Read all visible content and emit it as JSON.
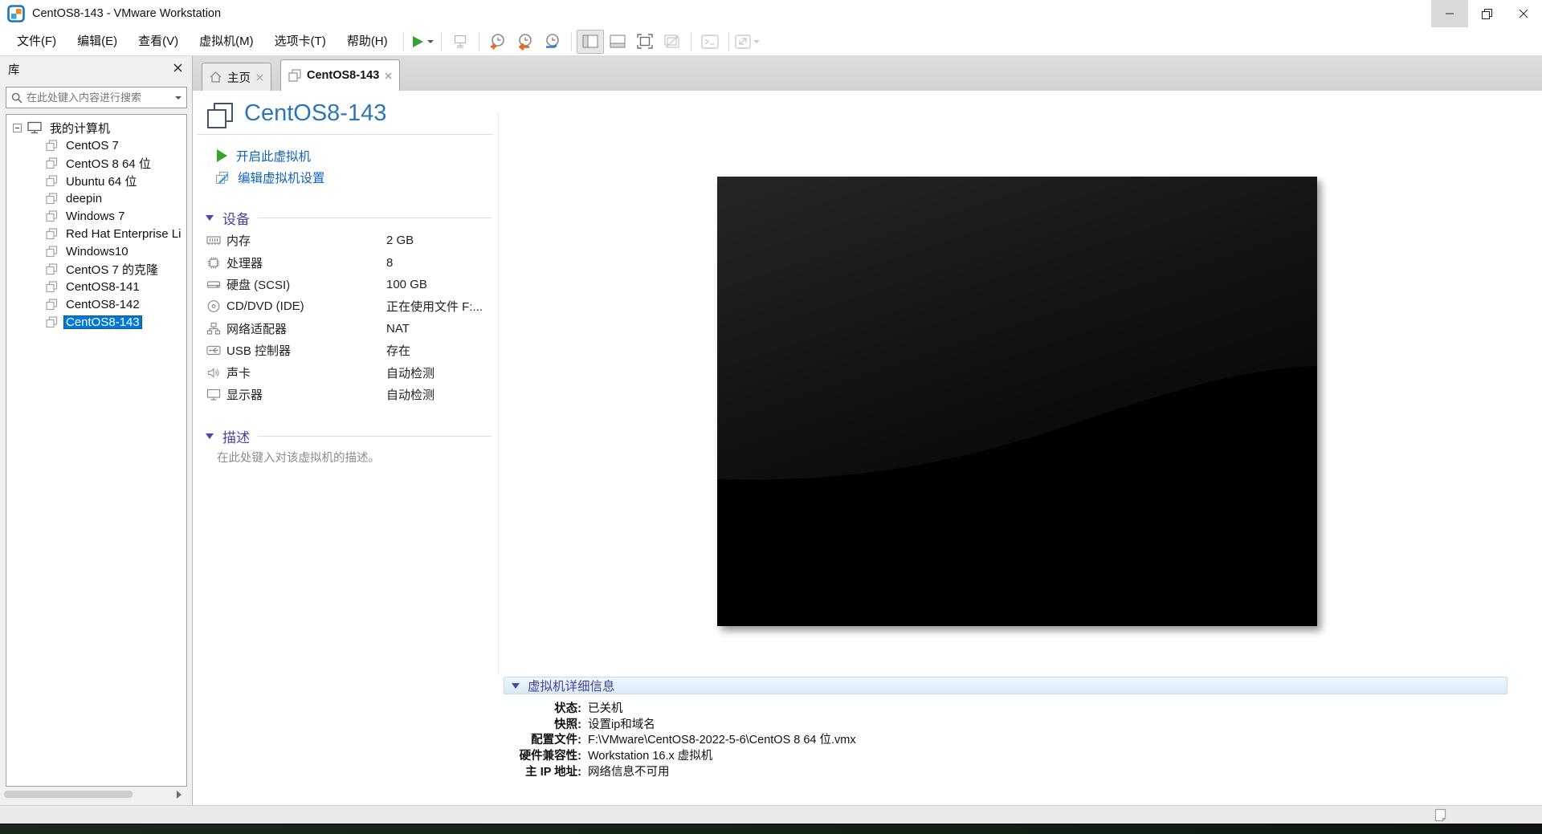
{
  "window": {
    "title": "CentOS8-143 - VMware Workstation"
  },
  "menu": {
    "items": [
      "文件(F)",
      "编辑(E)",
      "查看(V)",
      "虚拟机(M)",
      "选项卡(T)",
      "帮助(H)"
    ]
  },
  "toolbar": {
    "icons": [
      "power-on",
      "send-to-device",
      "take-snapshot",
      "revert-snapshot",
      "snapshot-manager",
      "show-library",
      "show-thumbnail-bar",
      "enter-fullscreen",
      "unity-mode",
      "virtual-console",
      "fit-guest-display"
    ]
  },
  "sidebar": {
    "title": "库",
    "search_placeholder": "在此处键入内容进行搜索",
    "tree": {
      "root": "我的计算机",
      "items": [
        "CentOS 7",
        "CentOS 8 64 位",
        "Ubuntu 64 位",
        "deepin",
        "Windows 7",
        "Red Hat Enterprise Li",
        "Windows10",
        "CentOS 7 的克隆",
        "CentOS8-141",
        "CentOS8-142",
        "CentOS8-143"
      ],
      "selected_item": "CentOS8-143"
    }
  },
  "tabs": {
    "home": "主页",
    "vm": "CentOS8-143"
  },
  "main": {
    "title": "CentOS8-143",
    "actions": {
      "power_on": "开启此虚拟机",
      "edit_settings": "编辑虚拟机设置"
    },
    "devices": {
      "heading": "设备",
      "rows": [
        {
          "icon": "memory-icon",
          "label": "内存",
          "value": "2 GB"
        },
        {
          "icon": "processor-icon",
          "label": "处理器",
          "value": "8"
        },
        {
          "icon": "harddisk-icon",
          "label": "硬盘 (SCSI)",
          "value": "100 GB"
        },
        {
          "icon": "cd-dvd-icon",
          "label": "CD/DVD (IDE)",
          "value": "正在使用文件 F:..."
        },
        {
          "icon": "network-adapter-icon",
          "label": "网络适配器",
          "value": "NAT"
        },
        {
          "icon": "usb-controller-icon",
          "label": "USB 控制器",
          "value": "存在"
        },
        {
          "icon": "sound-card-icon",
          "label": "声卡",
          "value": "自动检测"
        },
        {
          "icon": "display-icon",
          "label": "显示器",
          "value": "自动检测"
        }
      ]
    },
    "description": {
      "heading": "描述",
      "placeholder": "在此处键入对该虚拟机的描述。"
    },
    "details": {
      "heading": "虚拟机详细信息",
      "rows": [
        {
          "label": "状态:",
          "value": "已关机"
        },
        {
          "label": "快照:",
          "value": "设置ip和域名"
        },
        {
          "label": "配置文件:",
          "value": "F:\\VMware\\CentOS8-2022-5-6\\CentOS 8 64 位.vmx"
        },
        {
          "label": "硬件兼容性:",
          "value": "Workstation 16.x 虚拟机"
        },
        {
          "label": "主 IP 地址:",
          "value": "网络信息不可用"
        }
      ]
    }
  },
  "colors": {
    "selection": "#0078d7",
    "link": "#0f62ba",
    "title_blue": "#2e75b6",
    "section_heading": "#44449e",
    "power_green": "#35a22f",
    "snapshot_orange": "#e8641b",
    "snapshot_blue": "#2f7ed8"
  }
}
